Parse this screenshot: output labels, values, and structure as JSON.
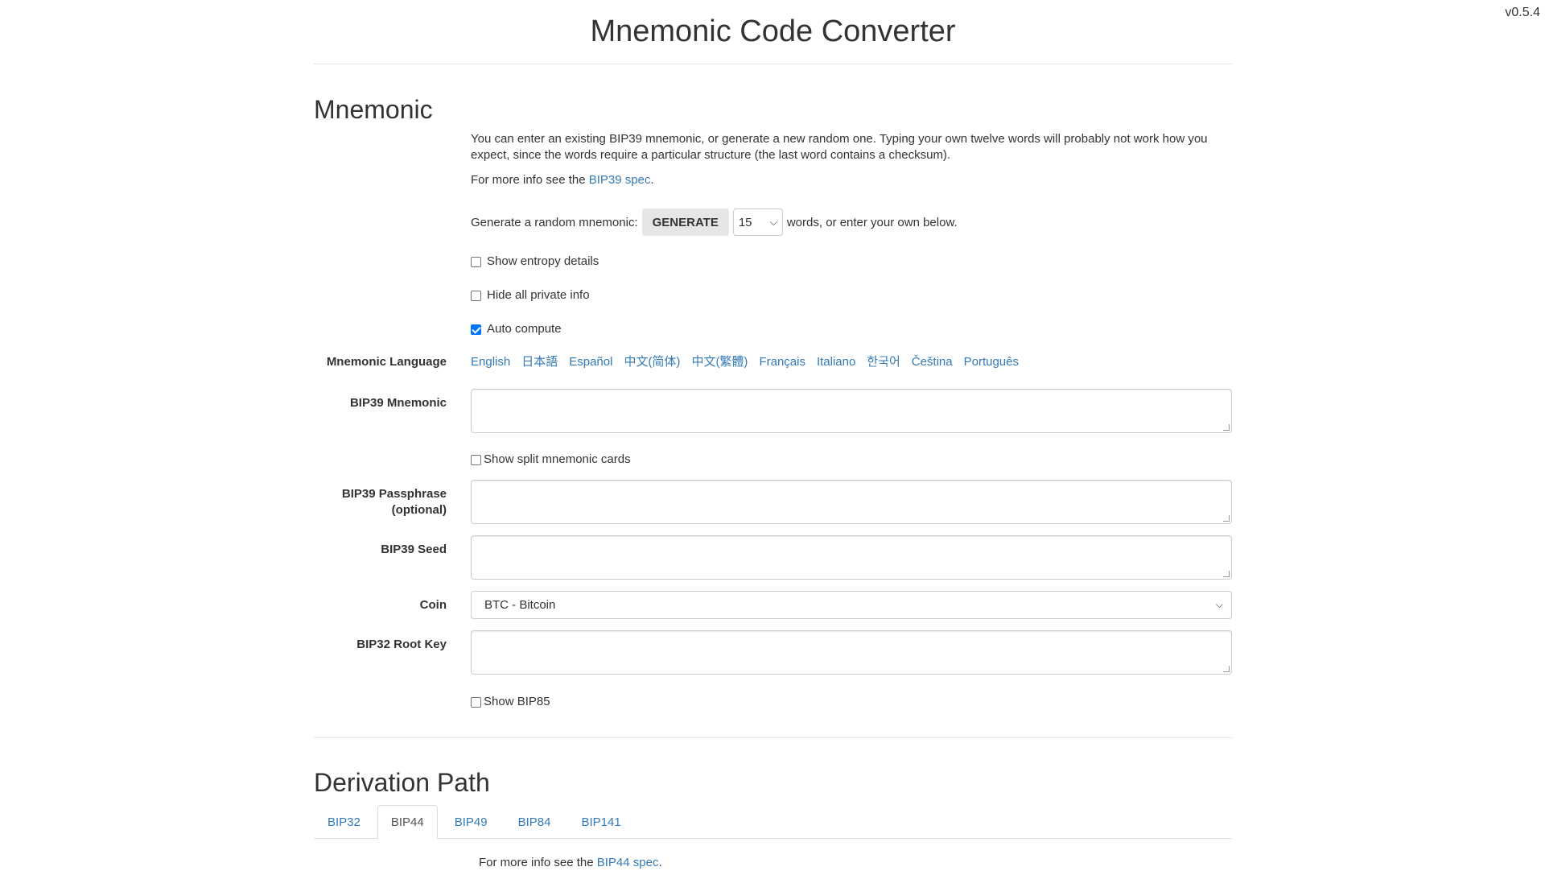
{
  "version": "v0.5.4",
  "header": {
    "title": "Mnemonic Code Converter"
  },
  "mnemonic_section": {
    "title": "Mnemonic",
    "intro": "You can enter an existing BIP39 mnemonic, or generate a new random one. Typing your own twelve words will probably not work how you expect, since the words require a particular structure (the last word contains a checksum).",
    "more_info_prefix": "For more info see the ",
    "more_info_link": "BIP39 spec",
    "more_info_suffix": ".",
    "generate_prefix": "Generate a random mnemonic:",
    "generate_button": "GENERATE",
    "word_count": "15",
    "generate_suffix": "words, or enter your own below.",
    "show_entropy_label": "Show entropy details",
    "show_entropy_checked": false,
    "hide_private_label": "Hide all private info",
    "hide_private_checked": false,
    "auto_compute_label": "Auto compute",
    "auto_compute_checked": true,
    "language_label": "Mnemonic Language",
    "languages": [
      "English",
      "日本語",
      "Español",
      "中文(简体)",
      "中文(繁體)",
      "Français",
      "Italiano",
      "한국어",
      "Čeština",
      "Português"
    ],
    "bip39_mnemonic_label": "BIP39 Mnemonic",
    "bip39_mnemonic_value": "",
    "split_cards_label": "Show split mnemonic cards",
    "passphrase_label_line1": "BIP39 Passphrase",
    "passphrase_label_line2": "(optional)",
    "passphrase_value": "",
    "seed_label": "BIP39 Seed",
    "seed_value": "",
    "coin_label": "Coin",
    "coin_value": "BTC - Bitcoin",
    "root_key_label": "BIP32 Root Key",
    "root_key_value": "",
    "show_bip85_label": "Show BIP85"
  },
  "derivation_section": {
    "title": "Derivation Path",
    "tabs": [
      "BIP32",
      "BIP44",
      "BIP49",
      "BIP84",
      "BIP141"
    ],
    "active_tab": "BIP44",
    "more_info_prefix": "For more info see the ",
    "more_info_link": "BIP44 spec",
    "more_info_suffix": "."
  },
  "colors": {
    "link": "#337ab7",
    "checkbox_checked": "#0075ff",
    "text": "#333333"
  }
}
